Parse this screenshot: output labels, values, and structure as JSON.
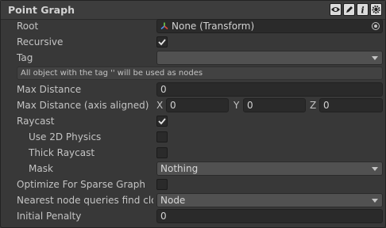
{
  "header": {
    "title": "Point Graph"
  },
  "rows": {
    "root": {
      "label": "Root",
      "value": "None (Transform)"
    },
    "recursive": {
      "label": "Recursive",
      "checked": true
    },
    "tag": {
      "label": "Tag",
      "value": ""
    },
    "help": "All object with the tag '' will be used as nodes",
    "max_distance": {
      "label": "Max Distance",
      "value": "0"
    },
    "max_distance_axis": {
      "label": "Max Distance (axis aligned)",
      "x_label": "X",
      "x": "0",
      "y_label": "Y",
      "y": "0",
      "z_label": "Z",
      "z": "0"
    },
    "raycast": {
      "label": "Raycast",
      "checked": true
    },
    "use_2d": {
      "label": "Use 2D Physics",
      "checked": false
    },
    "thick_raycast": {
      "label": "Thick Raycast",
      "checked": false
    },
    "mask": {
      "label": "Mask",
      "value": "Nothing"
    },
    "optimize_sparse": {
      "label": "Optimize For Sparse Graph",
      "checked": false
    },
    "nearest_query": {
      "label": "Nearest node queries find closest",
      "value": "Node"
    },
    "initial_penalty": {
      "label": "Initial Penalty",
      "value": "0"
    }
  },
  "icons": {
    "header_buttons": [
      "eye-icon",
      "pencil-icon",
      "info-icon",
      "gear-icon"
    ],
    "root_field": "transform-icon",
    "picker": "object-picker-icon"
  }
}
